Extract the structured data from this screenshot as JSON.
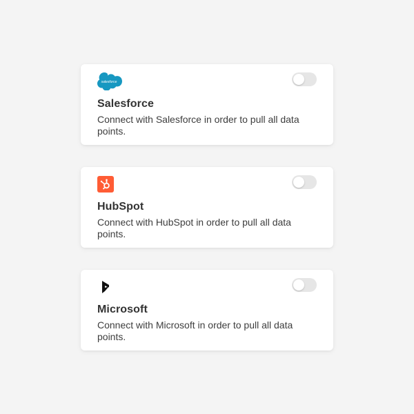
{
  "integrations": [
    {
      "name": "Salesforce",
      "logo": "salesforce-logo",
      "logo_text": "salesforce",
      "description": "Connect with Salesforce in order to pull all data points.",
      "enabled": false,
      "brand_color": "#1798c1"
    },
    {
      "name": "HubSpot",
      "logo": "hubspot-logo",
      "description": "Connect with HubSpot in order to pull all data points.",
      "enabled": false,
      "brand_color": "#ff5c35"
    },
    {
      "name": "Microsoft",
      "logo": "microsoft-dynamics-logo",
      "description": "Connect with Microsoft in order to pull all data points.",
      "enabled": false,
      "brand_color": "#111111"
    }
  ]
}
